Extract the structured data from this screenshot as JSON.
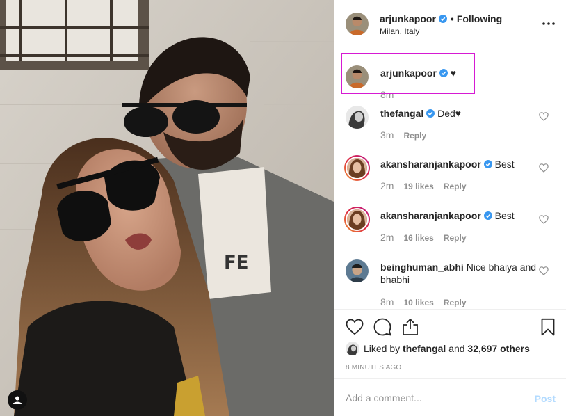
{
  "post": {
    "author": "arjunkapoor",
    "follow_status": "Following",
    "location": "Milan, Italy",
    "caption": "♥",
    "caption_time": "8m"
  },
  "comments": [
    {
      "user": "thefangal",
      "text": "Ded♥",
      "time": "3m",
      "likes": "",
      "reply": "Reply"
    },
    {
      "user": "akansharanjankapoor",
      "text": "Best",
      "time": "2m",
      "likes": "19 likes",
      "reply": "Reply"
    },
    {
      "user": "akansharanjankapoor",
      "text": "Best",
      "time": "2m",
      "likes": "16 likes",
      "reply": "Reply"
    },
    {
      "user": "beinghuman_abhi",
      "text": "Nice bhaiya and bhabhi",
      "time": "8m",
      "likes": "10 likes",
      "reply": "Reply"
    }
  ],
  "likes": {
    "prefix": "Liked by",
    "user": "thefangal",
    "joiner": "and",
    "others": "32,697 others"
  },
  "timestamp": "8 MINUTES AGO",
  "add_comment": {
    "placeholder": "Add a comment...",
    "post_label": "Post"
  },
  "icons": {
    "verified": "verified-badge-icon",
    "more": "more-options-icon",
    "like": "heart-icon",
    "comment": "comment-bubble-icon",
    "share": "share-icon",
    "save": "bookmark-icon",
    "tag": "user-tag-icon"
  },
  "colors": {
    "verified_blue": "#3897f0",
    "highlight_box": "#d61ad3",
    "muted_text": "#8e8e8e",
    "post_button_disabled": "#b3dbff"
  }
}
